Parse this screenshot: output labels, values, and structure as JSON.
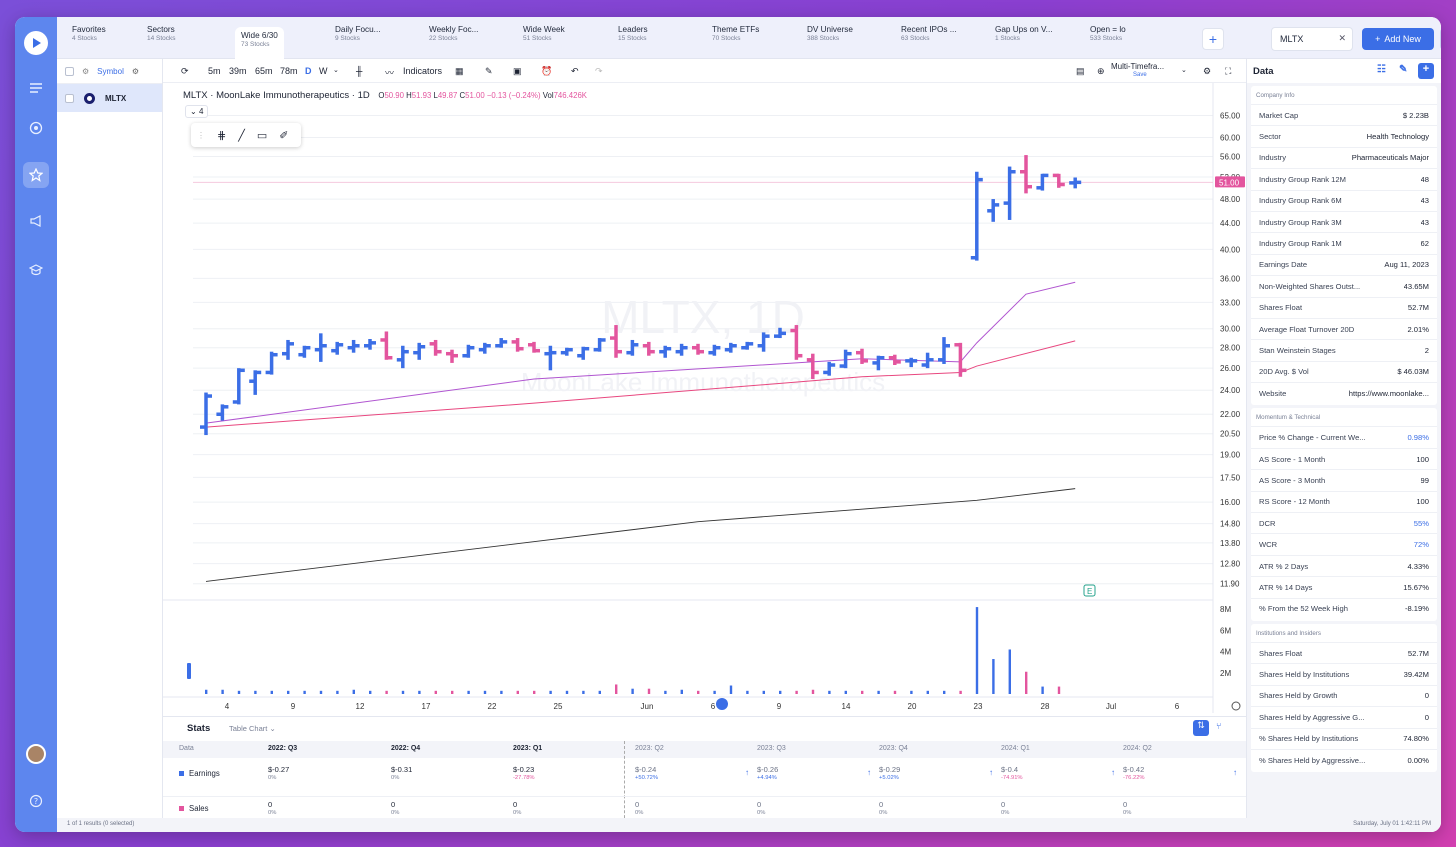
{
  "tabs": [
    {
      "name": "Favorites",
      "count": "4 Stocks",
      "x": 57
    },
    {
      "name": "Sectors",
      "count": "14 Stocks",
      "x": 132
    },
    {
      "name": "Wide 6/30",
      "count": "73 Stocks",
      "x": 220
    },
    {
      "name": "Daily Focu...",
      "count": "9 Stocks",
      "x": 320
    },
    {
      "name": "Weekly Foc...",
      "count": "22 Stocks",
      "x": 414
    },
    {
      "name": "Wide Week",
      "count": "51 Stocks",
      "x": 508
    },
    {
      "name": "Leaders",
      "count": "15 Stocks",
      "x": 603
    },
    {
      "name": "Theme ETFs",
      "count": "70 Stocks",
      "x": 697
    },
    {
      "name": "DV Universe",
      "count": "388 Stocks",
      "x": 792
    },
    {
      "name": "Recent IPOs ...",
      "count": "63 Stocks",
      "x": 886
    },
    {
      "name": "Gap Ups on V...",
      "count": "1 Stocks",
      "x": 980
    },
    {
      "name": "Open = lo",
      "count": "533 Stocks",
      "x": 1075
    }
  ],
  "ticker_input": "MLTX",
  "add_new_label": "Add New",
  "symbol_header": "Symbol",
  "symbols": [
    "MLTX"
  ],
  "timeframes": [
    "5m",
    "39m",
    "65m",
    "78m",
    "D",
    "W"
  ],
  "indicators_label": "Indicators",
  "layout_name": "Multi-Timefra...",
  "layout_save": "Save",
  "legend": {
    "title": "MLTX · MoonLake Immunotherapeutics · 1D",
    "o_label": "O",
    "o": "50.90",
    "h_label": "H",
    "h": "51.93",
    "l_label": "L",
    "l": "49.87",
    "c_label": "C",
    "c": "51.00",
    "chg": "−0.13 (−0.24%)",
    "vol_label": "Vol",
    "vol": "746.426K",
    "collapse": "4"
  },
  "watermark": {
    "line1": "MLTX, 1D",
    "line2": "MoonLake Immunotherapeutics"
  },
  "price_badge": "51.00",
  "chart_data": {
    "type": "ohlc",
    "price_axis": [
      "65.00",
      "60.00",
      "56.00",
      "52.00",
      "48.00",
      "44.00",
      "40.00",
      "36.00",
      "33.00",
      "30.00",
      "28.00",
      "26.00",
      "24.00",
      "22.00",
      "20.50",
      "19.00",
      "17.50",
      "16.00",
      "14.80",
      "13.80",
      "12.80",
      "11.90"
    ],
    "volume_axis": [
      "8M",
      "6M",
      "4M",
      "2M"
    ],
    "x_ticks": [
      "4",
      "9",
      "12",
      "17",
      "22",
      "25",
      "Jun",
      "6",
      "9",
      "14",
      "20",
      "23",
      "28",
      "Jul",
      "6"
    ],
    "bars": [
      {
        "o": 21.0,
        "h": 23.8,
        "l": 20.4,
        "c": 23.5
      },
      {
        "o": 22.0,
        "h": 22.8,
        "l": 21.5,
        "c": 22.6
      },
      {
        "o": 23.0,
        "h": 26.0,
        "l": 22.8,
        "c": 25.8
      },
      {
        "o": 24.8,
        "h": 25.8,
        "l": 23.6,
        "c": 25.6
      },
      {
        "o": 25.6,
        "h": 27.6,
        "l": 25.4,
        "c": 27.3
      },
      {
        "o": 27.4,
        "h": 28.8,
        "l": 26.8,
        "c": 28.4
      },
      {
        "o": 27.3,
        "h": 28.2,
        "l": 27.0,
        "c": 28.0
      },
      {
        "o": 27.8,
        "h": 29.5,
        "l": 26.6,
        "c": 28.2
      },
      {
        "o": 27.7,
        "h": 28.6,
        "l": 27.3,
        "c": 28.3
      },
      {
        "o": 28.0,
        "h": 28.8,
        "l": 27.5,
        "c": 28.2
      },
      {
        "o": 28.2,
        "h": 28.9,
        "l": 27.8,
        "c": 28.5
      },
      {
        "o": 28.8,
        "h": 29.7,
        "l": 26.8,
        "c": 27.0
      },
      {
        "o": 26.8,
        "h": 28.2,
        "l": 26.0,
        "c": 27.6
      },
      {
        "o": 27.5,
        "h": 28.5,
        "l": 26.8,
        "c": 28.1
      },
      {
        "o": 28.4,
        "h": 28.8,
        "l": 27.2,
        "c": 27.6
      },
      {
        "o": 27.4,
        "h": 27.8,
        "l": 26.5,
        "c": 27.2
      },
      {
        "o": 27.2,
        "h": 28.3,
        "l": 27.0,
        "c": 28.0
      },
      {
        "o": 27.8,
        "h": 28.5,
        "l": 27.4,
        "c": 28.2
      },
      {
        "o": 28.2,
        "h": 29.0,
        "l": 28.0,
        "c": 28.6
      },
      {
        "o": 28.6,
        "h": 29.0,
        "l": 27.6,
        "c": 27.9
      },
      {
        "o": 28.3,
        "h": 28.6,
        "l": 27.5,
        "c": 27.7
      },
      {
        "o": 27.4,
        "h": 28.2,
        "l": 25.8,
        "c": 27.5
      },
      {
        "o": 27.5,
        "h": 28.0,
        "l": 27.2,
        "c": 27.8
      },
      {
        "o": 27.2,
        "h": 28.1,
        "l": 26.8,
        "c": 27.9
      },
      {
        "o": 27.8,
        "h": 29.0,
        "l": 27.6,
        "c": 28.8
      },
      {
        "o": 29.0,
        "h": 30.4,
        "l": 27.0,
        "c": 27.6
      },
      {
        "o": 27.5,
        "h": 28.8,
        "l": 27.2,
        "c": 28.3
      },
      {
        "o": 28.2,
        "h": 28.6,
        "l": 27.2,
        "c": 27.6
      },
      {
        "o": 27.6,
        "h": 28.2,
        "l": 27.0,
        "c": 27.9
      },
      {
        "o": 27.6,
        "h": 28.4,
        "l": 27.2,
        "c": 28.0
      },
      {
        "o": 28.0,
        "h": 28.4,
        "l": 27.3,
        "c": 27.6
      },
      {
        "o": 27.5,
        "h": 28.3,
        "l": 27.2,
        "c": 28.0
      },
      {
        "o": 27.8,
        "h": 28.5,
        "l": 27.5,
        "c": 28.2
      },
      {
        "o": 28.0,
        "h": 28.6,
        "l": 27.8,
        "c": 28.4
      },
      {
        "o": 28.2,
        "h": 29.6,
        "l": 27.6,
        "c": 29.2
      },
      {
        "o": 29.2,
        "h": 30.1,
        "l": 29.0,
        "c": 29.5
      },
      {
        "o": 29.8,
        "h": 30.4,
        "l": 26.8,
        "c": 27.2
      },
      {
        "o": 26.8,
        "h": 27.4,
        "l": 25.0,
        "c": 25.6
      },
      {
        "o": 25.6,
        "h": 26.6,
        "l": 25.3,
        "c": 26.3
      },
      {
        "o": 26.2,
        "h": 27.8,
        "l": 26.0,
        "c": 27.4
      },
      {
        "o": 27.5,
        "h": 27.9,
        "l": 26.4,
        "c": 26.7
      },
      {
        "o": 26.5,
        "h": 27.2,
        "l": 25.8,
        "c": 27.0
      },
      {
        "o": 27.0,
        "h": 27.3,
        "l": 26.3,
        "c": 26.6
      },
      {
        "o": 26.7,
        "h": 27.0,
        "l": 26.1,
        "c": 26.7
      },
      {
        "o": 26.3,
        "h": 27.5,
        "l": 26.0,
        "c": 26.8
      },
      {
        "o": 26.8,
        "h": 29.1,
        "l": 26.4,
        "c": 28.2
      },
      {
        "o": 28.3,
        "h": 28.5,
        "l": 25.2,
        "c": 25.8
      },
      {
        "o": 38.8,
        "h": 53.0,
        "l": 38.4,
        "c": 51.5
      },
      {
        "o": 46.0,
        "h": 48.0,
        "l": 44.2,
        "c": 47.0
      },
      {
        "o": 47.3,
        "h": 54.0,
        "l": 44.5,
        "c": 53.0
      },
      {
        "o": 53.0,
        "h": 56.3,
        "l": 49.0,
        "c": 50.2
      },
      {
        "o": 50.0,
        "h": 52.6,
        "l": 49.5,
        "c": 52.3
      },
      {
        "o": 52.3,
        "h": 52.6,
        "l": 50.0,
        "c": 50.6
      },
      {
        "o": 50.9,
        "h": 51.9,
        "l": 49.9,
        "c": 51.0
      }
    ],
    "ma_purple": [
      [
        0,
        21.3
      ],
      [
        20,
        25.0
      ],
      [
        40,
        26.9
      ],
      [
        46,
        26.6
      ],
      [
        47,
        28.5
      ],
      [
        50,
        34.0
      ],
      [
        53,
        35.5
      ]
    ],
    "ma_pink": [
      [
        0,
        21.0
      ],
      [
        20,
        22.9
      ],
      [
        40,
        25.2
      ],
      [
        46,
        25.6
      ],
      [
        47,
        26.2
      ],
      [
        53,
        28.7
      ]
    ],
    "ma_black": [
      [
        0,
        12.0
      ],
      [
        30,
        14.9
      ],
      [
        47,
        16.1
      ],
      [
        53,
        16.8
      ]
    ],
    "volume": [
      0.4,
      0.4,
      0.3,
      0.3,
      0.3,
      0.3,
      0.3,
      0.3,
      0.3,
      0.4,
      0.3,
      0.3,
      0.3,
      0.3,
      0.3,
      0.3,
      0.3,
      0.3,
      0.3,
      0.3,
      0.3,
      0.3,
      0.3,
      0.3,
      0.3,
      0.9,
      0.5,
      0.5,
      0.3,
      0.4,
      0.3,
      0.3,
      0.8,
      0.3,
      0.3,
      0.3,
      0.3,
      0.4,
      0.3,
      0.3,
      0.3,
      0.3,
      0.3,
      0.3,
      0.3,
      0.3,
      0.3,
      8.2,
      3.3,
      4.2,
      2.1,
      0.7,
      0.7
    ]
  },
  "stats": {
    "title": "Stats",
    "subtitle": "Table Chart",
    "header_label": "Data",
    "periods": [
      "2022: Q3",
      "2022: Q4",
      "2023: Q1",
      "2023: Q2",
      "2023: Q3",
      "2023: Q4",
      "2024: Q1",
      "2024: Q2"
    ],
    "rows": [
      {
        "label": "Earnings",
        "color": "#3b6ee6",
        "values": [
          "$-0.27",
          "$-0.31",
          "$-0.23",
          "$-0.24",
          "$-0.26",
          "$-0.29",
          "$-0.4",
          "$-0.42"
        ],
        "changes": [
          "0%",
          "0%",
          "-27.78%",
          "+50.72%",
          "+4.94%",
          "+5.02%",
          "-74.91%",
          "-76.22%"
        ]
      },
      {
        "label": "Sales",
        "color": "#e3559e",
        "values": [
          "0",
          "0",
          "0",
          "0",
          "0",
          "0",
          "0",
          "0"
        ],
        "changes": [
          "0%",
          "0%",
          "0%",
          "0%",
          "0%",
          "0%",
          "0%",
          "0%"
        ]
      }
    ]
  },
  "data_panel": {
    "title": "Data",
    "sections": [
      {
        "title": "Company Info",
        "rows": [
          [
            "Market Cap",
            "$ 2.23B"
          ],
          [
            "Sector",
            "Health Technology"
          ],
          [
            "Industry",
            "Pharmaceuticals Major"
          ],
          [
            "Industry Group Rank 12M",
            "48"
          ],
          [
            "Industry Group Rank 6M",
            "43"
          ],
          [
            "Industry Group Rank 3M",
            "43"
          ],
          [
            "Industry Group Rank 1M",
            "62"
          ],
          [
            "Earnings Date",
            "Aug 11, 2023"
          ],
          [
            "Non-Weighted Shares Outst...",
            "43.65M"
          ],
          [
            "Shares Float",
            "52.7M"
          ],
          [
            "Average Float Turnover 20D",
            "2.01%"
          ],
          [
            "Stan Weinstein Stages",
            "2"
          ],
          [
            "20D Avg. $ Vol",
            "$ 46.03M"
          ],
          [
            "Website",
            "https://www.moonlake..."
          ]
        ]
      },
      {
        "title": "Momentum & Technical",
        "rows": [
          [
            "Price % Change - Current We...",
            "0.98%"
          ],
          [
            "AS Score - 1 Month",
            "100"
          ],
          [
            "AS Score - 3 Month",
            "99"
          ],
          [
            "RS Score - 12 Month",
            "100"
          ],
          [
            "DCR",
            "55%"
          ],
          [
            "WCR",
            "72%"
          ],
          [
            "ATR % 2 Days",
            "4.33%"
          ],
          [
            "ATR % 14 Days",
            "15.67%"
          ],
          [
            "% From the 52 Week High",
            "-8.19%"
          ]
        ]
      },
      {
        "title": "Institutions and Insiders",
        "rows": [
          [
            "Shares Float",
            "52.7M"
          ],
          [
            "Shares Held by Institutions",
            "39.42M"
          ],
          [
            "Shares Held by Growth",
            "0"
          ],
          [
            "Shares Held by Aggressive G...",
            "0"
          ],
          [
            "% Shares Held by Institutions",
            "74.80%"
          ],
          [
            "% Shares Held by Aggressive...",
            "0.00%"
          ]
        ]
      }
    ]
  },
  "status_left": "1 of 1 results (0 selected)",
  "status_right": "Saturday, July 01 1:42:11 PM",
  "colors": {
    "up": "#3b6ee6",
    "down": "#e3559e",
    "accent": "#3b6ee6"
  }
}
